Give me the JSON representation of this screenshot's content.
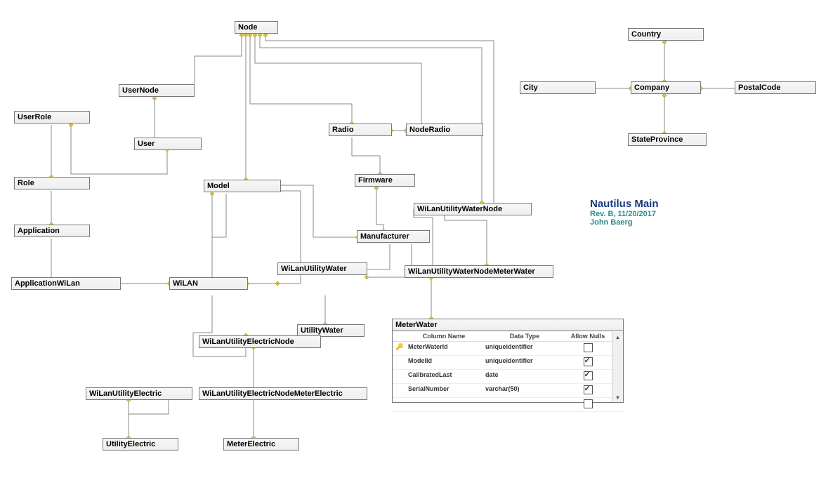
{
  "title": {
    "main": "Nautilus Main",
    "rev": "Rev. B, 11/20/2017",
    "author": "John Baerg"
  },
  "entities": {
    "Node": "Node",
    "UserNode": "UserNode",
    "UserRole": "UserRole",
    "User": "User",
    "Role": "Role",
    "Application": "Application",
    "ApplicationWiLan": "ApplicationWiLan",
    "WiLAN": "WiLAN",
    "Model": "Model",
    "Radio": "Radio",
    "NodeRadio": "NodeRadio",
    "Firmware": "Firmware",
    "Manufacturer": "Manufacturer",
    "WiLanUtilityWater": "WiLanUtilityWater",
    "WiLanUtilityWaterNode": "WiLanUtilityWaterNode",
    "WiLanUtilityWaterNodeMeterWater": "WiLanUtilityWaterNodeMeterWater",
    "UtilityWater": "UtilityWater",
    "WiLanUtilityElectricNode": "WiLanUtilityElectricNode",
    "WiLanUtilityElectric": "WiLanUtilityElectric",
    "WiLanUtilityElectricNodeMeterElectric": "WiLanUtilityElectricNodeMeterElectric",
    "UtilityElectric": "UtilityElectric",
    "MeterElectric": "MeterElectric",
    "Country": "Country",
    "City": "City",
    "Company": "Company",
    "PostalCode": "PostalCode",
    "StateProvince": "StateProvince",
    "MeterWater": "MeterWater"
  },
  "meterWaterTable": {
    "headers": {
      "col": "Column Name",
      "type": "Data Type",
      "nulls": "Allow Nulls"
    },
    "rows": [
      {
        "key": true,
        "name": "MeterWaterId",
        "type": "uniqueidentifier",
        "nulls": false
      },
      {
        "key": false,
        "name": "ModelId",
        "type": "uniqueidentifier",
        "nulls": true
      },
      {
        "key": false,
        "name": "CalibratedLast",
        "type": "date",
        "nulls": true
      },
      {
        "key": false,
        "name": "SerialNumber",
        "type": "varchar(50)",
        "nulls": true
      },
      {
        "key": false,
        "name": "",
        "type": "",
        "nulls": false
      }
    ]
  }
}
